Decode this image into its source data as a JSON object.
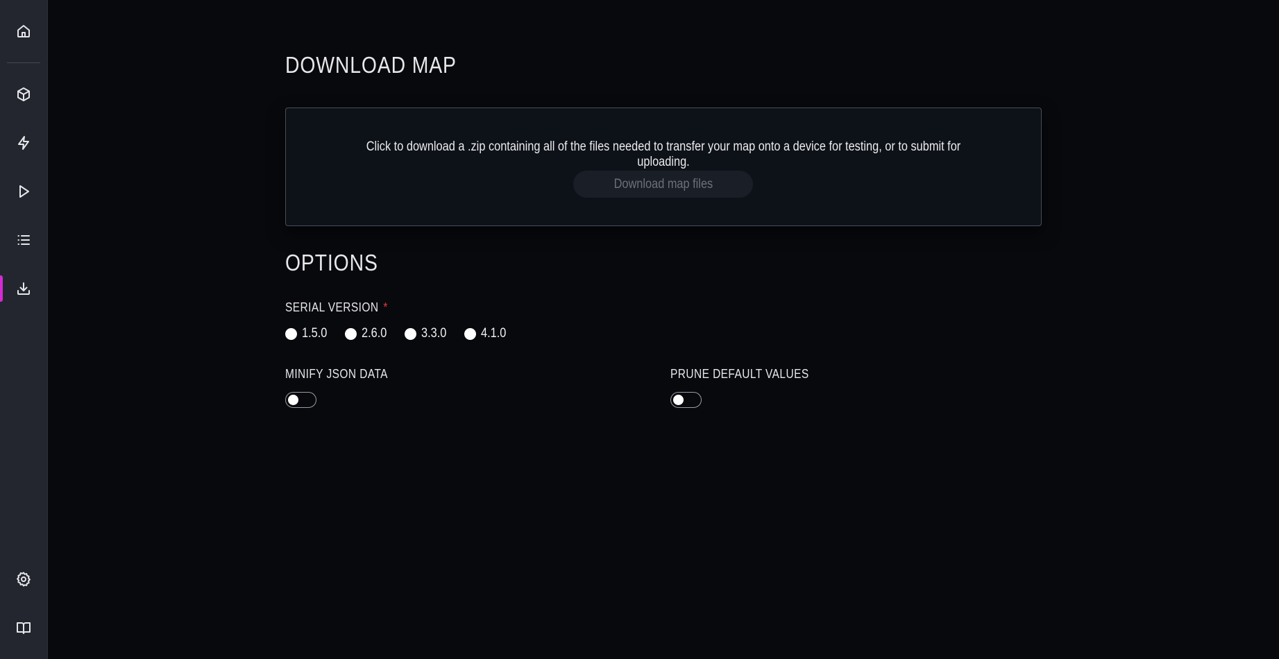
{
  "sidebar": {
    "accent_color": "#d42bd2",
    "top_items": [
      {
        "icon": "home-icon",
        "active": false
      },
      {
        "icon": "cube-icon",
        "active": false
      },
      {
        "icon": "lightning-icon",
        "active": false
      },
      {
        "icon": "play-icon",
        "active": false
      },
      {
        "icon": "list-icon",
        "active": false
      },
      {
        "icon": "download-icon",
        "active": true
      }
    ],
    "bottom_items": [
      {
        "icon": "gear-icon"
      },
      {
        "icon": "book-icon"
      }
    ]
  },
  "page": {
    "title": "DOWNLOAD MAP"
  },
  "download_card": {
    "description": "Click to download a .zip containing all of the files needed to transfer your map onto a device for testing, or to submit for uploading.",
    "button_label": "Download map files",
    "button_disabled": true
  },
  "options": {
    "title": "OPTIONS",
    "serial_version": {
      "label": "SERIAL VERSION",
      "required_marker": "*",
      "choices": [
        "1.5.0",
        "2.6.0",
        "3.3.0",
        "4.1.0"
      ],
      "selected": null
    },
    "minify_json": {
      "label": "MINIFY JSON DATA",
      "enabled": false
    },
    "prune_defaults": {
      "label": "PRUNE DEFAULT VALUES",
      "enabled": false
    }
  }
}
